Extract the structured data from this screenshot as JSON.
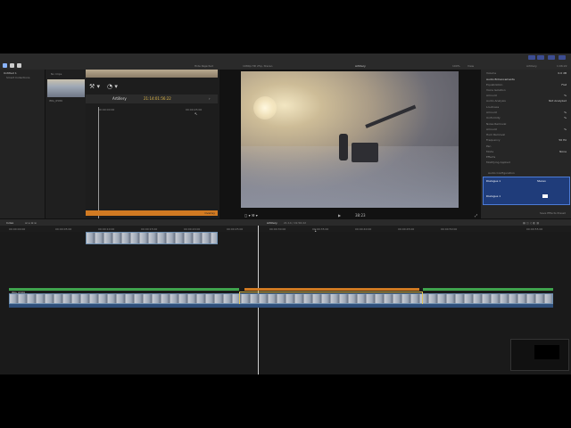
{
  "toolbar": {
    "library": "Untitled 1",
    "hide_rejected": "Hide Rejected",
    "format": "1080p HD 25p, Stereo",
    "project_title": "Artillery",
    "zoom": "100%",
    "view": "View",
    "clip_name": "Artillery",
    "duration": "1:06:22"
  },
  "sidebar": {
    "items": [
      "Untitled 1",
      "Smart Collections"
    ]
  },
  "browser": {
    "header": "No Clips",
    "clip_label": "IMG_6589"
  },
  "clip_inspector": {
    "name": "Artillery",
    "timecode": "21:14:01:56:22",
    "left_tc": "00:00:00:00",
    "right_tc": "00:00:25:00",
    "bar_label": "Overlay"
  },
  "viewer": {
    "timecode": "38:23"
  },
  "inspector": {
    "header": "Audio Enhancements",
    "rows": [
      {
        "label": "Volume",
        "value": "0.0 dB"
      },
      {
        "label": "Audio Enhancements",
        "value": ""
      },
      {
        "label": "Equalization",
        "value": "Flat"
      },
      {
        "label": "Voice Isolation",
        "value": ""
      },
      {
        "label": "Amount",
        "value": "%"
      },
      {
        "label": "Audio Analysis",
        "value": "Not Analyzed"
      },
      {
        "label": "Loudness",
        "value": ""
      },
      {
        "label": "Amount",
        "value": "%"
      },
      {
        "label": "Uniformity",
        "value": "%"
      },
      {
        "label": "Noise Removal",
        "value": ""
      },
      {
        "label": "Amount",
        "value": "%"
      },
      {
        "label": "Hum Removal",
        "value": ""
      },
      {
        "label": "Frequency",
        "value": "50 Hz"
      },
      {
        "label": "Pan",
        "value": ""
      },
      {
        "label": "Mode",
        "value": "None"
      },
      {
        "label": "Effects",
        "value": ""
      },
      {
        "label": "Modifying Applied",
        "value": ""
      }
    ],
    "audio_config": "Audio Configuration",
    "dialogue1": "Dialogue 1",
    "stereo": "Stereo",
    "dialogue2": "Dialogue 1",
    "save_preset": "Save Effects Preset"
  },
  "timeline": {
    "index": "Index",
    "project": "Artillery",
    "duration": "21:14 / 01:56:22",
    "ruler": [
      "00:00:00:00",
      "00:00:05:00",
      "00:00:10:00",
      "00:00:15:00",
      "00:00:20:00",
      "00:00:25:00",
      "00:00:30:00",
      "00:00:35:00",
      "00:00:40:00",
      "00:00:45:00",
      "00:00:50:00",
      "00:00:55:00"
    ],
    "top_clip_label": "Overlay",
    "primary_label": "IMG_6589"
  },
  "colors": {
    "accent": "#3b69c4",
    "orange": "#d17a22",
    "green": "#3fa34d",
    "selection": "#e0c35a"
  }
}
